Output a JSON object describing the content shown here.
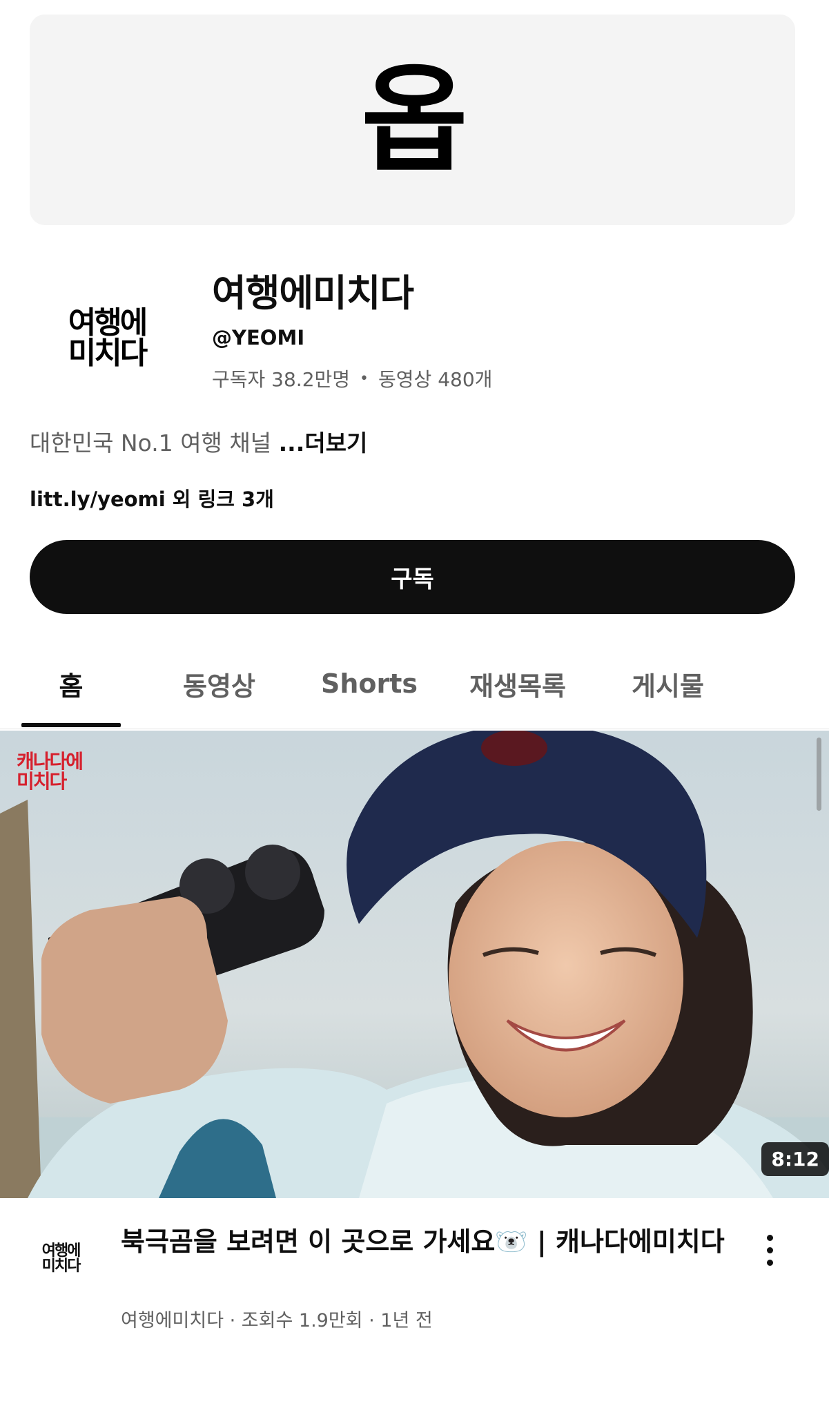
{
  "banner": {
    "logo_text": "옵"
  },
  "channel": {
    "avatar_text_line1": "여행에",
    "avatar_text_line2": "미치다",
    "name": "여행에미치다",
    "handle": "@YEOMI",
    "subscribers": "구독자 38.2만명",
    "video_count": "동영상 480개",
    "description": "대한민국 No.1 여행 채널",
    "more_label": "...더보기",
    "links": "litt.ly/yeomi 외 링크 3개",
    "subscribe_label": "구독"
  },
  "tabs": [
    {
      "label": "홈",
      "active": true
    },
    {
      "label": "동영상",
      "active": false
    },
    {
      "label": "Shorts",
      "active": false
    },
    {
      "label": "재생목록",
      "active": false
    },
    {
      "label": "게시물",
      "active": false
    }
  ],
  "video": {
    "thumbnail_badge_line1": "캐나다에",
    "thumbnail_badge_line2": "미치다",
    "duration": "8:12",
    "title": "북극곰을 보려면 이 곳으로 가세요🐻‍❄️ | 캐나다에미치다",
    "channel": "여행에미치다",
    "views": "조회수 1.9만회",
    "age": "1년 전",
    "meta_separator": " · "
  },
  "colors": {
    "subscribe_bg": "#0f0f0f",
    "secondary_text": "#606060",
    "badge_red": "#d6202d"
  }
}
